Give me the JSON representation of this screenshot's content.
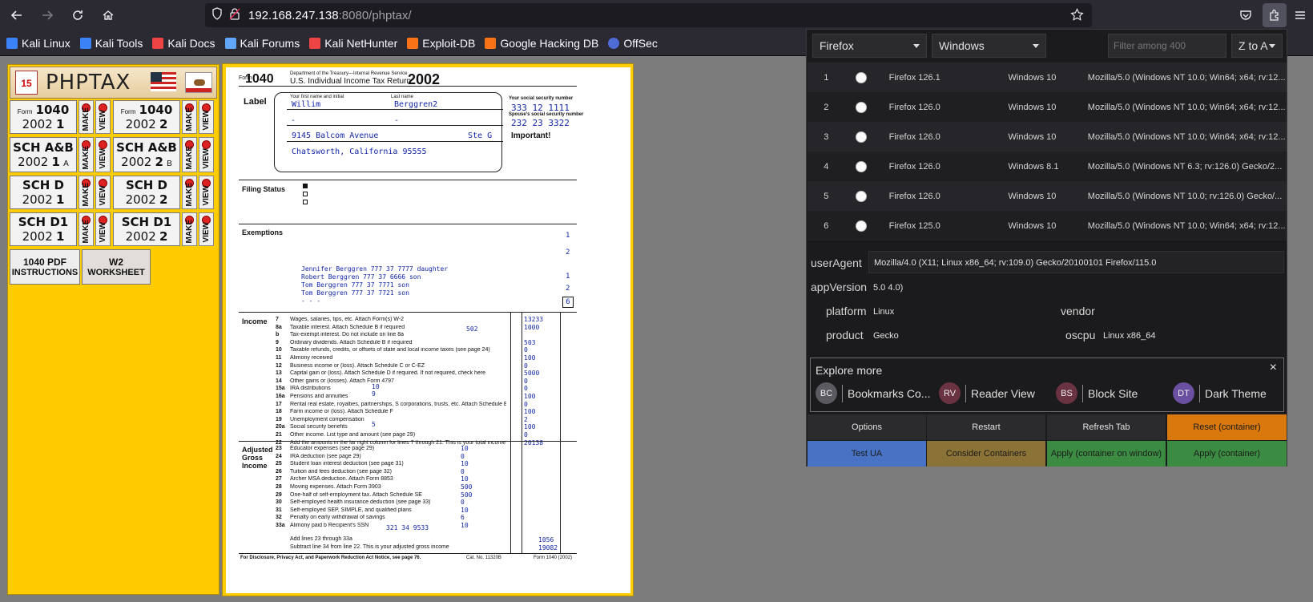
{
  "browser": {
    "url_host": "192.168.247.138",
    "url_rest": ":8080/phptax/",
    "bookmarks": [
      "Kali Linux",
      "Kali Tools",
      "Kali Docs",
      "Kali Forums",
      "Kali NetHunter",
      "Exploit-DB",
      "Google Hacking DB",
      "OffSec"
    ],
    "bookmark_colors": [
      "#3b82f6",
      "#3b82f6",
      "#ef4444",
      "#60a5fa",
      "#ef4444",
      "#f97316",
      "#f97316",
      "#4f6bd6"
    ]
  },
  "phptax": {
    "title": "PHPTAX",
    "tiles": [
      {
        "top": "1040",
        "form_prefix": "Form",
        "year": "2002",
        "num": "1",
        "top2": "1040",
        "year2": "2002",
        "num2": "2"
      },
      {
        "top": "SCH A&B",
        "letter": "A",
        "year": "2002",
        "num": "1",
        "top2": "SCH A&B",
        "letter2": "B",
        "year2": "2002",
        "num2": "2"
      },
      {
        "top": "SCH D",
        "year": "2002",
        "num": "1",
        "top2": "SCH D",
        "year2": "2002",
        "num2": "2"
      },
      {
        "top": "SCH D1",
        "year": "2002",
        "num": "1",
        "top2": "SCH D1",
        "year2": "2002",
        "num2": "2"
      }
    ],
    "make_label": "MAKE",
    "view_label": "VIEW",
    "pdf_instructions": [
      "1040 PDF",
      "INSTRUCTIONS"
    ],
    "w2_worksheet": [
      "W2",
      "WORKSHEET"
    ]
  },
  "form1040": {
    "form_no": "1040",
    "header_dept": "Department of the Treasury—Internal Revenue Service",
    "header_title": "U.S. Individual Income Tax Return",
    "year": "2002",
    "first_name": "Willim",
    "last_name": "Berggren2",
    "ssn": [
      "333",
      "12",
      "1111"
    ],
    "spouse_ssn": [
      "232",
      "23",
      "3322"
    ],
    "address": "9145 Balcom Avenue",
    "apt": "Ste G",
    "city": "Chatsworth, California 95555",
    "label_section": "Label",
    "filing_status": "Filing Status",
    "exemptions": "Exemptions",
    "income": "Income",
    "agi": "Adjusted Gross Income",
    "important": "Important!",
    "dependents": [
      [
        "Jennifer",
        "Berggren",
        "777",
        "37",
        "7777",
        "daughter"
      ],
      [
        "Robert",
        "Berggren",
        "777",
        "37",
        "6666",
        "son"
      ],
      [
        "Tom",
        "Berggren",
        "777",
        "37",
        "7771",
        "son"
      ],
      [
        "Tom",
        "Berggren",
        "777",
        "37",
        "7721",
        "son"
      ],
      [
        "-",
        "-",
        "",
        "",
        "",
        "-"
      ]
    ],
    "exemption_boxes": [
      "1",
      "2",
      "1",
      "2",
      "6"
    ],
    "income_lines": [
      {
        "n": "7",
        "label": "Wages, salaries, tips, etc. Attach Form(s) W-2",
        "v": "13233"
      },
      {
        "n": "8a",
        "label": "Taxable interest. Attach Schedule B if required",
        "v": "1000"
      },
      {
        "n": "b",
        "label": "Tax-exempt interest. Do not include on line 8a",
        "v": ""
      },
      {
        "n": "9",
        "label": "Ordinary dividends. Attach Schedule B if required",
        "v": "503"
      },
      {
        "n": "10",
        "label": "Taxable refunds, credits, or offsets of state and local income taxes (see page 24)",
        "v": "0"
      },
      {
        "n": "11",
        "label": "Alimony received",
        "v": "100"
      },
      {
        "n": "12",
        "label": "Business income or (loss). Attach Schedule C or C-EZ",
        "v": "0"
      },
      {
        "n": "13",
        "label": "Capital gain or (loss). Attach Schedule D if required. If not required, check here",
        "v": "5000"
      },
      {
        "n": "14",
        "label": "Other gains or (losses). Attach Form 4797",
        "v": "0"
      },
      {
        "n": "15a",
        "label": "IRA distributions",
        "v": "0"
      },
      {
        "n": "16a",
        "label": "Pensions and annuities",
        "v": "100"
      },
      {
        "n": "17",
        "label": "Rental real estate, royalties, partnerships, S corporations, trusts, etc. Attach Schedule E",
        "v": "0"
      },
      {
        "n": "18",
        "label": "Farm income or (loss). Attach Schedule F",
        "v": "100"
      },
      {
        "n": "19",
        "label": "Unemployment compensation",
        "v": "2"
      },
      {
        "n": "20a",
        "label": "Social security benefits",
        "v": "100"
      },
      {
        "n": "21",
        "label": "Other income. List type and amount (see page 29)",
        "v": "0"
      },
      {
        "n": "22",
        "label": "Add the amounts in the far right column for lines 7 through 21. This is your total income",
        "v": "20138"
      }
    ],
    "line_8b": "502",
    "line_15a_amt": "10",
    "line_16a_amt": "9",
    "line_20a_amt": "5",
    "agi_lines": [
      {
        "n": "23",
        "label": "Educator expenses (see page 29)",
        "v": "10"
      },
      {
        "n": "24",
        "label": "IRA deduction (see page 29)",
        "v": "0"
      },
      {
        "n": "25",
        "label": "Student loan interest deduction (see page 31)",
        "v": "10"
      },
      {
        "n": "26",
        "label": "Tuition and fees deduction (see page 32)",
        "v": "0"
      },
      {
        "n": "27",
        "label": "Archer MSA deduction. Attach Form 8853",
        "v": "10"
      },
      {
        "n": "28",
        "label": "Moving expenses. Attach Form 3903",
        "v": "500"
      },
      {
        "n": "29",
        "label": "One-half of self-employment tax. Attach Schedule SE",
        "v": "500"
      },
      {
        "n": "30",
        "label": "Self-employed health insurance deduction (see page 33)",
        "v": "0"
      },
      {
        "n": "31",
        "label": "Self-employed SEP, SIMPLE, and qualified plans",
        "v": "10"
      },
      {
        "n": "32",
        "label": "Penalty on early withdrawal of savings",
        "v": "6"
      },
      {
        "n": "33a",
        "label": "Alimony paid  b Recipient's SSN",
        "v": "10"
      }
    ],
    "alimony_ssn": [
      "321",
      "34",
      "9533"
    ],
    "line34_label": "Add lines 23 through 33a",
    "line34": "1056",
    "line35_label": "Subtract line 34 from line 22. This is your adjusted gross income",
    "line35": "19082",
    "footer": "For Disclosure, Privacy Act, and Paperwork Reduction Act Notice, see page 76.",
    "cat_no": "Cat. No. 11320B",
    "footer_form": "Form 1040 (2002)"
  },
  "ua_switcher": {
    "browser_select": "Firefox",
    "os_select": "Windows",
    "filter_placeholder": "Filter among 400",
    "sort_select": "Z to A",
    "rows": [
      {
        "idx": "1",
        "name": "Firefox 126.1",
        "os": "Windows 10",
        "ua": "Mozilla/5.0 (Windows NT 10.0; Win64; x64; rv:12..."
      },
      {
        "idx": "2",
        "name": "Firefox 126.0",
        "os": "Windows 10",
        "ua": "Mozilla/5.0 (Windows NT 10.0; Win64; x64; rv:12..."
      },
      {
        "idx": "3",
        "name": "Firefox 126.0",
        "os": "Windows 10",
        "ua": "Mozilla/5.0 (Windows NT 10.0; Win64; x64; rv:12..."
      },
      {
        "idx": "4",
        "name": "Firefox 126.0",
        "os": "Windows 8.1",
        "ua": "Mozilla/5.0 (Windows NT 6.3; rv:126.0) Gecko/2..."
      },
      {
        "idx": "5",
        "name": "Firefox 126.0",
        "os": "Windows 10",
        "ua": "Mozilla/5.0 (Windows NT 10.0; rv:126.0) Gecko/..."
      },
      {
        "idx": "6",
        "name": "Firefox 125.0",
        "os": "Windows 10",
        "ua": "Mozilla/5.0 (Windows NT 10.0; Win64; x64; rv:12..."
      }
    ],
    "useragent_label": "userAgent",
    "useragent_value": "Mozilla/4.0 (X11; Linux x86_64; rv:109.0) Gecko/20100101 Firefox/115.0",
    "appversion_label": "appVersion",
    "appversion_value": "5.0 4.0)",
    "platform_label": "platform",
    "platform_value": "Linux",
    "vendor_label": "vendor",
    "vendor_value": "",
    "product_label": "product",
    "product_value": "Gecko",
    "oscpu_label": "oscpu",
    "oscpu_value": "Linux x86_64",
    "explore_title": "Explore more",
    "explore_close": "×",
    "explore_items": [
      {
        "abbr": "BC",
        "label": "Bookmarks Co...",
        "color": "#5a5a60"
      },
      {
        "abbr": "RV",
        "label": "Reader View",
        "color": "#6a3342"
      },
      {
        "abbr": "BS",
        "label": "Block Site",
        "color": "#6a3342"
      },
      {
        "abbr": "DT",
        "label": "Dark Theme",
        "color": "#6b4fa0"
      }
    ],
    "buttons_row1": [
      "Options",
      "Restart",
      "Refresh Tab",
      "Reset (container)"
    ],
    "buttons_row2": [
      "Test UA",
      "Consider Containers",
      "Apply (container on window)",
      "Apply (container)"
    ]
  }
}
